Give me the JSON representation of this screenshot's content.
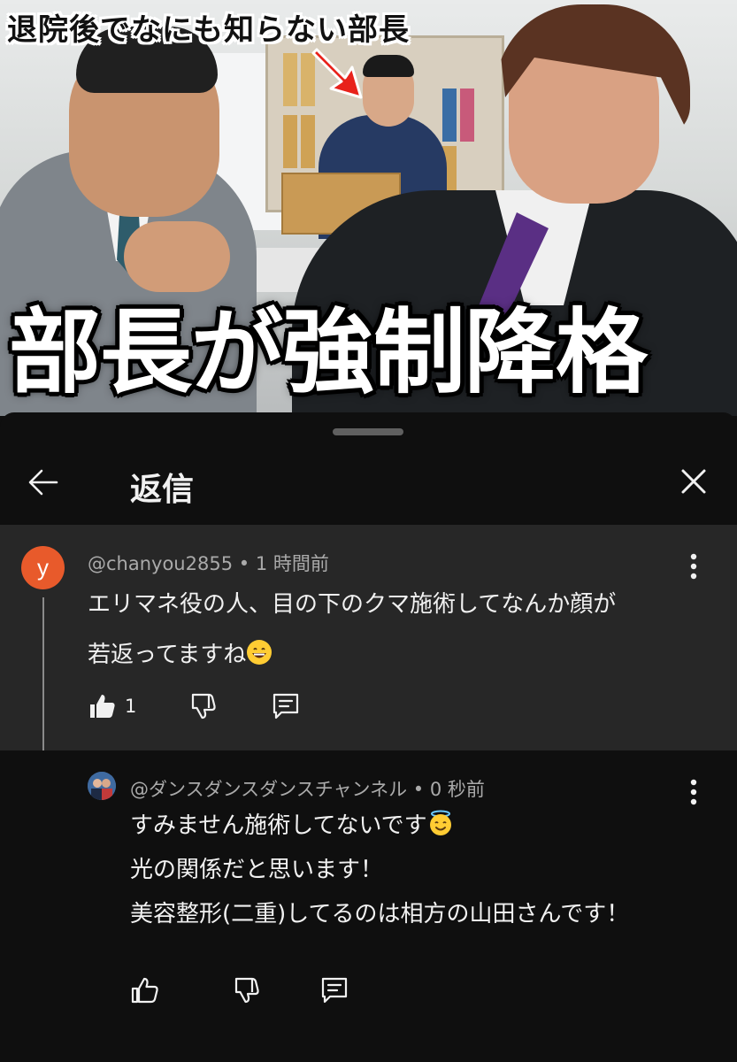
{
  "thumbnail": {
    "caption_top": "退院後でなにも知らない部長",
    "caption_big": "部長が強制降格"
  },
  "sheet": {
    "title": "返信"
  },
  "parent_comment": {
    "avatar_letter": "y",
    "author": "@chanyou2855",
    "time": "1 時間前",
    "lines": [
      "エリマネ役の人、目の下のクマ施術してなんか顔が",
      "若返ってますね"
    ],
    "emoji": "grinning-face-with-smiling-eyes",
    "like_count": "1"
  },
  "reply_comment": {
    "author": "@ダンスダンスダンスチャンネル",
    "time": "0 秒前",
    "lines": [
      "すみません施術してないです",
      "光の関係だと思います！",
      "美容整形(二重)してるのは相方の山田さんです！"
    ],
    "emoji": "smiling-face-with-halo"
  },
  "colors": {
    "background": "#0f0f0f",
    "parent_highlight": "#272727",
    "avatar_y": "#e85a2b",
    "secondary_text": "#aaaaaa"
  }
}
